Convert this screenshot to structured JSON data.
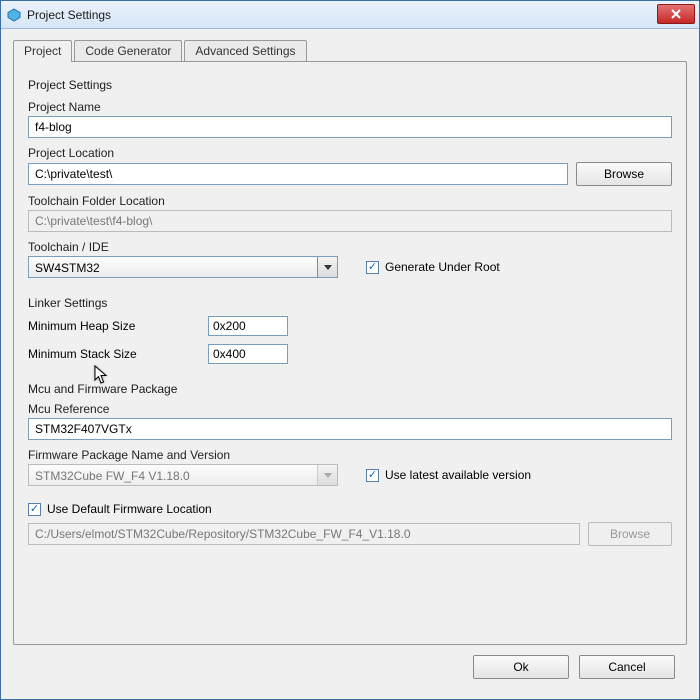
{
  "title": "Project Settings",
  "tabs": {
    "project": "Project",
    "codegen": "Code Generator",
    "advanced": "Advanced Settings"
  },
  "sections": {
    "projectSettings": "Project Settings",
    "linker": "Linker Settings",
    "mcu": "Mcu and Firmware Package"
  },
  "labels": {
    "projectName": "Project Name",
    "projectLocation": "Project Location",
    "toolchainFolder": "Toolchain Folder Location",
    "toolchainIde": "Toolchain / IDE",
    "generateUnderRoot": "Generate Under Root",
    "minHeap": "Minimum Heap Size",
    "minStack": "Minimum Stack Size",
    "mcuRef": "Mcu Reference",
    "fwName": "Firmware Package Name and Version",
    "useLatest": "Use latest available version",
    "useDefaultFw": "Use Default Firmware Location"
  },
  "values": {
    "projectName": "f4-blog",
    "projectLocation": "C:\\private\\test\\",
    "toolchainFolder": "C:\\private\\test\\f4-blog\\",
    "toolchainIde": "SW4STM32",
    "minHeap": "0x200",
    "minStack": "0x400",
    "mcuRef": "STM32F407VGTx",
    "fwName": "STM32Cube FW_F4 V1.18.0",
    "fwLocation": "C:/Users/elmot/STM32Cube/Repository/STM32Cube_FW_F4_V1.18.0"
  },
  "buttons": {
    "browse": "Browse",
    "ok": "Ok",
    "cancel": "Cancel"
  }
}
